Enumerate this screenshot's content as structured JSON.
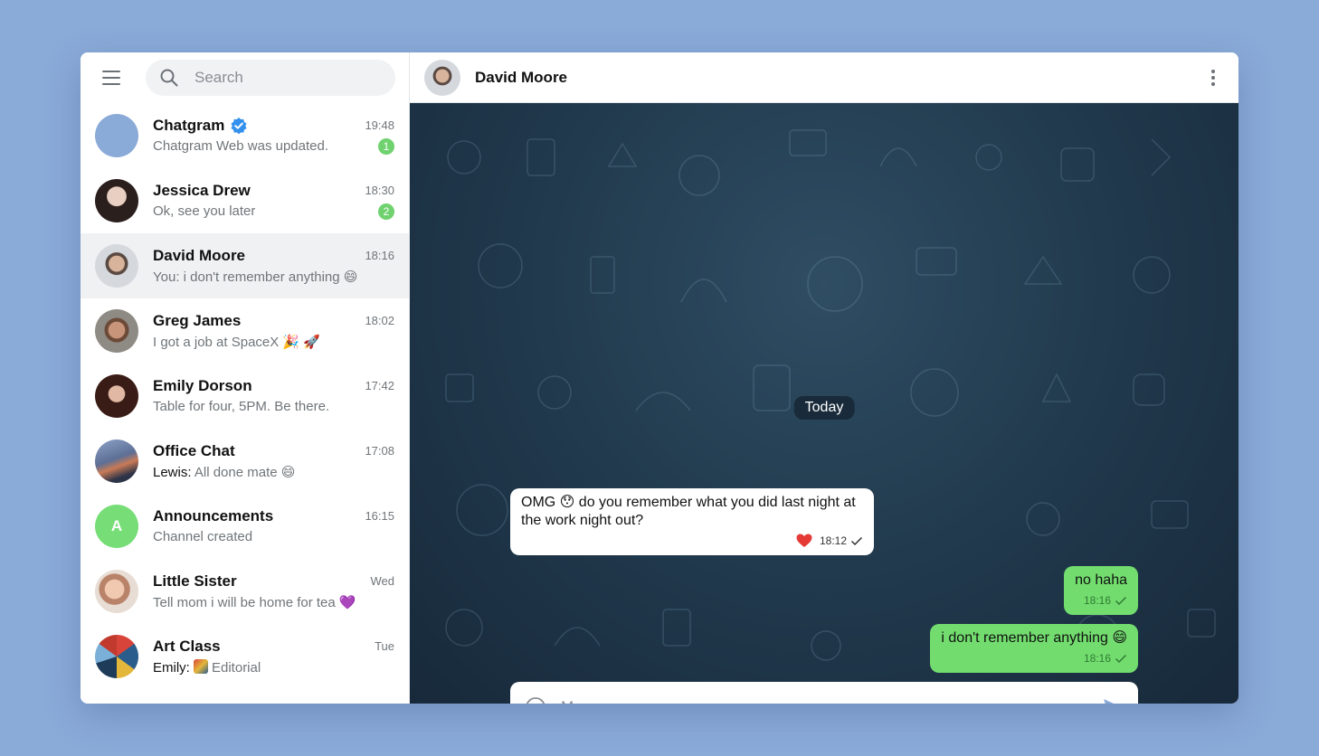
{
  "search": {
    "placeholder": "Search"
  },
  "chats": [
    {
      "name": "Chatgram",
      "time": "19:48",
      "message": "Chatgram Web was updated.",
      "sender": "",
      "badge": "1",
      "verified": true,
      "avatar_color": "#8aaad8",
      "avatar_letter": ""
    },
    {
      "name": "Jessica Drew",
      "time": "18:30",
      "message": "Ok, see you later",
      "sender": "",
      "badge": "2",
      "avatar_color": "#3a2c2a",
      "avatar_letter": ""
    },
    {
      "name": "David Moore",
      "time": "18:16",
      "message": "You: i don't remember anything 😄",
      "sender": "",
      "badge": "",
      "avatar_color": "#c9cdd2",
      "avatar_letter": ""
    },
    {
      "name": "Greg James",
      "time": "18:02",
      "message": "I got a job at SpaceX 🎉 🚀",
      "sender": "",
      "badge": "",
      "avatar_color": "#6d5a4c",
      "avatar_letter": ""
    },
    {
      "name": "Emily Dorson",
      "time": "17:42",
      "message": "Table for four, 5PM. Be there.",
      "sender": "",
      "badge": "",
      "avatar_color": "#4a2a22",
      "avatar_letter": ""
    },
    {
      "name": "Office Chat",
      "time": "17:08",
      "message": "All done mate 😄",
      "sender": "Lewis: ",
      "badge": "",
      "avatar_color": "#5b6a8c",
      "avatar_letter": ""
    },
    {
      "name": "Announcements",
      "time": "16:15",
      "message": "Channel created",
      "sender": "",
      "badge": "",
      "avatar_color": "#77dd77",
      "avatar_letter": "A"
    },
    {
      "name": "Little Sister",
      "time": "Wed",
      "message": "Tell mom i will be home for tea 💜",
      "sender": "",
      "badge": "",
      "avatar_color": "#d8a58a",
      "avatar_letter": ""
    },
    {
      "name": "Art Class",
      "time": "Tue",
      "message": "Editorial",
      "sender": "Emily: ",
      "badge": "",
      "avatar_color": "#2b5f8a",
      "avatar_letter": ""
    }
  ],
  "header": {
    "name": "David Moore"
  },
  "conversation": {
    "date_label": "Today",
    "messages": [
      {
        "text": "OMG 😯 do you remember what you did last night at the work night out?",
        "time": "18:12",
        "direction": "in",
        "reaction": "heart"
      },
      {
        "text": "no haha",
        "time": "18:16",
        "direction": "out"
      },
      {
        "text": "i don't remember anything 😄",
        "time": "18:16",
        "direction": "out"
      }
    ]
  },
  "composer": {
    "placeholder": "Message"
  },
  "colors": {
    "accent": "#8aaad8",
    "outgoing": "#72dd6e",
    "badge": "#6fd26f",
    "verified": "#3390ec"
  }
}
